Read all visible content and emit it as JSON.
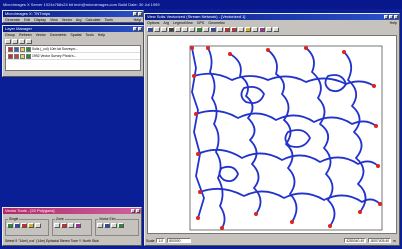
{
  "desktop": {
    "title": "MicroImages X Server  1024x768x24 bit  tech@microimages.com  Build Date: 30 Jul 1999"
  },
  "main_window": {
    "title": "MicroImages X: TNTmips",
    "menu": [
      "Generate",
      "Edit",
      "Display",
      "View",
      "Vector",
      "Arg",
      "Calculate",
      "Tools"
    ],
    "help": "Help"
  },
  "layer_manager": {
    "title": "Layer Manager",
    "menu": [
      "Group",
      "Refresh",
      "Vector",
      "Geometric",
      "Spatial",
      "Tools",
      "Help"
    ],
    "layers": [
      {
        "label": "Soils (_col)  10m lat Surveyor...",
        "icon_color": "#3a56c8"
      },
      {
        "label": "1992 Vector Survey Photo's...",
        "icon_color": "#d04040"
      }
    ]
  },
  "view_window": {
    "title": "View Soils Vectorized (Stream Network) - [Vectorized 1]",
    "menu": [
      "Options",
      "Arg",
      "LegendView",
      "GPS",
      "Geometric"
    ],
    "help": "Help",
    "status": {
      "label": "Scale",
      "scale_label": "1:0",
      "zoom": "800000",
      "coord_x": "4280040.40",
      "coord_y": "-8007405.40",
      "unit": "m"
    }
  },
  "vector_window": {
    "title": "Vector Tools - [20 Polygons]",
    "groups": [
      "Single",
      "Zone",
      "Vector Elm"
    ],
    "status_text": "Select 9 \"14mil_rus\" (14m) Epitaxial Stereo Tone Y. North Stub"
  },
  "colors": {
    "desktop": "#0a1f96",
    "title_bar": "#0a1e8a",
    "contour": "#2233cc",
    "node": "#dd2222"
  }
}
